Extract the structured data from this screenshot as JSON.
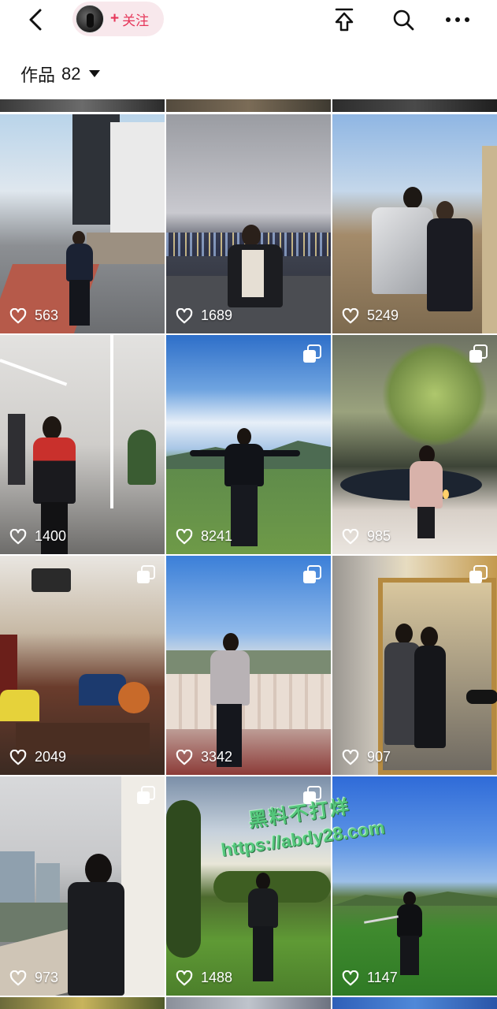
{
  "header": {
    "follow_label": "关注",
    "follow_plus": "+",
    "icons": [
      "back-icon",
      "share-icon",
      "search-icon",
      "more-icon"
    ]
  },
  "works": {
    "label": "作品",
    "count": "82"
  },
  "posts": [
    {
      "likes": "563",
      "multi": false
    },
    {
      "likes": "1689",
      "multi": false
    },
    {
      "likes": "5249",
      "multi": false
    },
    {
      "likes": "1400",
      "multi": false
    },
    {
      "likes": "8241",
      "multi": true
    },
    {
      "likes": "985",
      "multi": true
    },
    {
      "likes": "2049",
      "multi": true
    },
    {
      "likes": "3342",
      "multi": true
    },
    {
      "likes": "907",
      "multi": true
    },
    {
      "likes": "973",
      "multi": true
    },
    {
      "likes": "1488",
      "multi": true
    },
    {
      "likes": "1147",
      "multi": false
    }
  ],
  "watermark": {
    "line1": "黑料不打烊",
    "line2": "https://abdy28.com"
  },
  "colors": {
    "accent": "#e6375a",
    "pill_bg": "#f8e8ec",
    "watermark": "#55c77c"
  }
}
